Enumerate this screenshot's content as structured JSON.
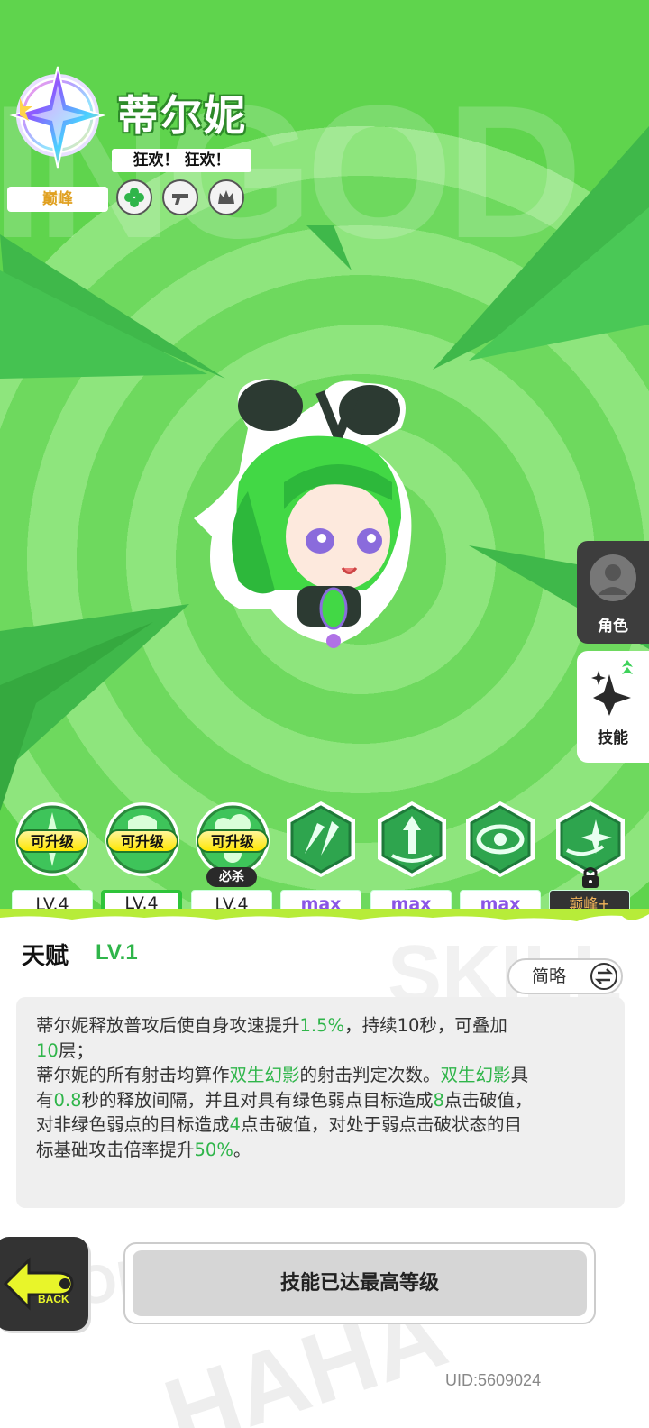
{
  "background": {
    "word": "INGOD",
    "panel_word": "SKILL",
    "deco_bottom": "HAHA",
    "deco_left": "NOR"
  },
  "header": {
    "name": "蒂尔妮",
    "tagline": "狂欢！ 狂欢！",
    "rank": "巅峰",
    "traits": [
      "clover-icon",
      "gun-icon",
      "crown-icon"
    ]
  },
  "side_tabs": [
    {
      "label": "角色",
      "icon": "character-avatar-icon",
      "active": false
    },
    {
      "label": "技能",
      "icon": "sparkle-star-icon",
      "active": true
    }
  ],
  "skills": [
    {
      "icon": "star-burst-icon",
      "upgrade_label": "可升级",
      "level": "LV.4",
      "selected": false
    },
    {
      "icon": "shield-orb-icon",
      "upgrade_label": "可升级",
      "level": "LV.4",
      "selected": true
    },
    {
      "icon": "cloud-orb-icon",
      "upgrade_label": "可升级",
      "level": "LV.4",
      "selected": false,
      "tag": "必杀"
    },
    {
      "icon": "triple-arrow-icon",
      "level": "max"
    },
    {
      "icon": "rising-arrows-icon",
      "level": "max"
    },
    {
      "icon": "vortex-eye-icon",
      "level": "max"
    },
    {
      "icon": "comet-star-icon",
      "level": "巅峰+",
      "locked": true
    }
  ],
  "talent": {
    "title": "天赋",
    "level": "LV.1",
    "brief_label": "简略",
    "desc": {
      "l1a": "蒂尔妮释放普攻后使自身攻速提升",
      "l1b": "1.5%",
      "l1c": "，持续10秒，可叠加",
      "l2a": "10",
      "l2b": "层；",
      "l3a": "蒂尔妮的所有射击均算作",
      "l3b": "双生幻影",
      "l3c": "的射击判定次数。",
      "l3d": "双生幻影",
      "l3e": "具",
      "l4a": "有",
      "l4b": "0.8",
      "l4c": "秒的释放间隔，并且对具有绿色弱点目标造成",
      "l4d": "8",
      "l4e": "点击破值，",
      "l5a": "对非绿色弱点的目标造成",
      "l5b": "4",
      "l5c": "点击破值，对处于弱点击破状态的目",
      "l6a": "标基础攻击倍率提升",
      "l6b": "50%",
      "l6c": "。"
    }
  },
  "footer": {
    "back_label": "BACK",
    "max_button_label": "技能已达最高等级",
    "uid": "UID:5609024"
  },
  "colors": {
    "bg_green": "#5ad14a",
    "highlight": "#2fb54a",
    "max_purple": "#8a55e6",
    "peak_gold": "#f0b35a"
  }
}
